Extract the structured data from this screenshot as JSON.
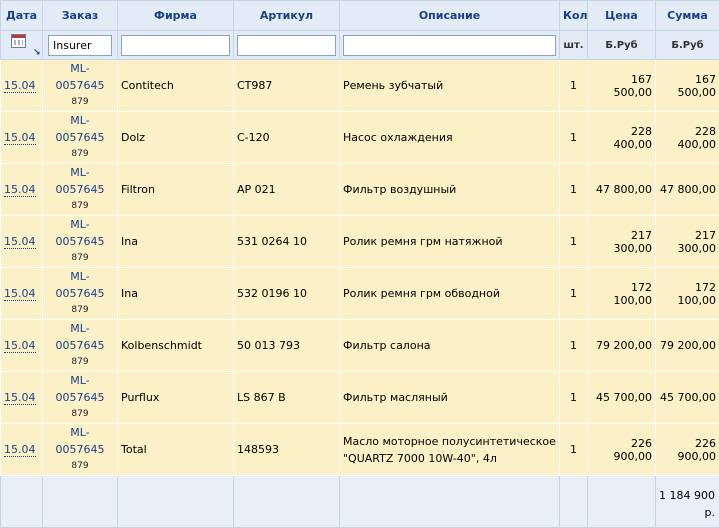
{
  "header": {
    "columns": [
      {
        "key": "date",
        "label": "Дата"
      },
      {
        "key": "order",
        "label": "Заказ"
      },
      {
        "key": "firm",
        "label": "Фирма"
      },
      {
        "key": "article",
        "label": "Артикул"
      },
      {
        "key": "desc",
        "label": "Описание"
      },
      {
        "key": "qty",
        "label": "Кол"
      },
      {
        "key": "price",
        "label": "Цена"
      },
      {
        "key": "sum",
        "label": "Сумма"
      }
    ],
    "units": {
      "qty": "шт.",
      "price": "Б.Руб",
      "sum": "Б.Руб"
    },
    "filters": {
      "order": "Insurer",
      "firm": "",
      "article": "",
      "desc": ""
    }
  },
  "rows": [
    {
      "date": "15.04",
      "order": "ML-0057645",
      "order_sub": "879",
      "firm": "Contitech",
      "article": "CT987",
      "desc": "Ремень зубчатый",
      "qty": "1",
      "price": "167 500,00",
      "sum": "167 500,00"
    },
    {
      "date": "15.04",
      "order": "ML-0057645",
      "order_sub": "879",
      "firm": "Dolz",
      "article": "C-120",
      "desc": "Насос охлаждения",
      "qty": "1",
      "price": "228 400,00",
      "sum": "228 400,00"
    },
    {
      "date": "15.04",
      "order": "ML-0057645",
      "order_sub": "879",
      "firm": "Filtron",
      "article": "AP 021",
      "desc": "Фильтр воздушный",
      "qty": "1",
      "price": "47 800,00",
      "sum": "47 800,00"
    },
    {
      "date": "15.04",
      "order": "ML-0057645",
      "order_sub": "879",
      "firm": "Ina",
      "article": "531 0264 10",
      "desc": "Ролик ремня грм натяжной",
      "qty": "1",
      "price": "217 300,00",
      "sum": "217 300,00"
    },
    {
      "date": "15.04",
      "order": "ML-0057645",
      "order_sub": "879",
      "firm": "Ina",
      "article": "532 0196 10",
      "desc": "Ролик ремня грм обводной",
      "qty": "1",
      "price": "172 100,00",
      "sum": "172 100,00"
    },
    {
      "date": "15.04",
      "order": "ML-0057645",
      "order_sub": "879",
      "firm": "Kolbenschmidt",
      "article": "50 013 793",
      "desc": "Фильтр салона",
      "qty": "1",
      "price": "79 200,00",
      "sum": "79 200,00"
    },
    {
      "date": "15.04",
      "order": "ML-0057645",
      "order_sub": "879",
      "firm": "Purflux",
      "article": "LS 867 B",
      "desc": "Фильтр масляный",
      "qty": "1",
      "price": "45 700,00",
      "sum": "45 700,00"
    },
    {
      "date": "15.04",
      "order": "ML-0057645",
      "order_sub": "879",
      "firm": "Total",
      "article": "148593",
      "desc": "Масло моторное полусинтетическое \"QUARTZ 7000 10W-40\", 4л",
      "qty": "1",
      "price": "226 900,00",
      "sum": "226 900,00"
    }
  ],
  "footer": {
    "total_amount": "1 184 900",
    "total_currency": "р."
  },
  "icons": {
    "date_filter": "calendar-icon",
    "sort": "sort-desc-arrow-icon"
  },
  "colors": {
    "header_bg": "#e2ebf6",
    "header_text": "#15428b",
    "row_bg": "#fbf0c6",
    "footer_bg": "#e8eff8"
  }
}
